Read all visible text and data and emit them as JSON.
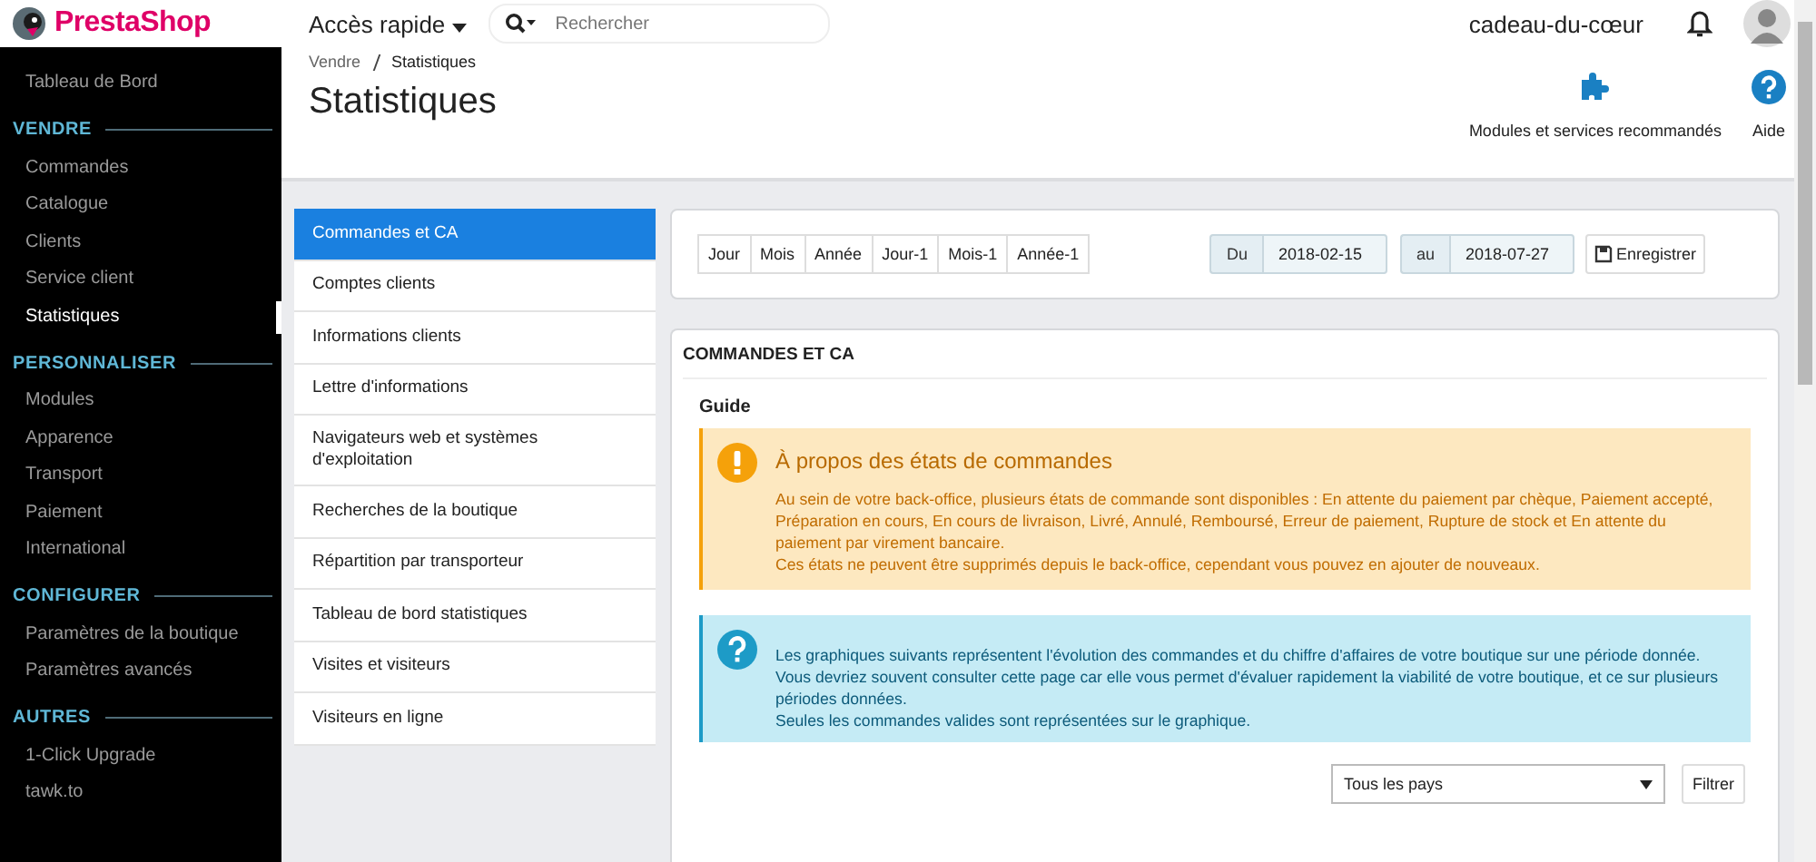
{
  "header": {
    "logo": "PrestaShop",
    "quick_access": "Accès rapide",
    "search": {
      "placeholder": "Rechercher"
    },
    "shop": "cadeau-du-cœur"
  },
  "sidebar": {
    "top_item": {
      "label": "Tableau de Bord",
      "selected": false
    },
    "sections": [
      {
        "title": "VENDRE",
        "items": [
          {
            "label": "Commandes",
            "selected": false
          },
          {
            "label": "Catalogue",
            "selected": false
          },
          {
            "label": "Clients",
            "selected": false
          },
          {
            "label": "Service client",
            "selected": false
          },
          {
            "label": "Statistiques",
            "selected": true
          }
        ]
      },
      {
        "title": "PERSONNALISER",
        "items": [
          {
            "label": "Modules",
            "selected": false
          },
          {
            "label": "Apparence",
            "selected": false
          },
          {
            "label": "Transport",
            "selected": false
          },
          {
            "label": "Paiement",
            "selected": false
          },
          {
            "label": "International",
            "selected": false
          }
        ]
      },
      {
        "title": "CONFIGURER",
        "items": [
          {
            "label": "Paramètres de la boutique",
            "selected": false
          },
          {
            "label": "Paramètres avancés",
            "selected": false
          }
        ]
      },
      {
        "title": "AUTRES",
        "items": [
          {
            "label": "1-Click Upgrade",
            "selected": false
          },
          {
            "label": "tawk.to",
            "selected": false
          }
        ]
      }
    ]
  },
  "breadcrumb": [
    "Vendre",
    "Statistiques"
  ],
  "page_title": "Statistiques",
  "toolbar": [
    {
      "kind": "modules",
      "label": "Modules et services recommandés"
    },
    {
      "kind": "help",
      "label": "Aide"
    }
  ],
  "stats_menu": [
    {
      "label": "Commandes et CA",
      "selected": true
    },
    {
      "label": "Comptes clients",
      "selected": false
    },
    {
      "label": "Informations clients",
      "selected": false
    },
    {
      "label": "Lettre d'informations",
      "selected": false
    },
    {
      "label": "Navigateurs web et systèmes d'exploitation",
      "selected": false
    },
    {
      "label": "Recherches de la boutique",
      "selected": false
    },
    {
      "label": "Répartition par transporteur",
      "selected": false
    },
    {
      "label": "Tableau de bord statistiques",
      "selected": false
    },
    {
      "label": "Visites et visiteurs",
      "selected": false
    },
    {
      "label": "Visiteurs en ligne",
      "selected": false
    }
  ],
  "period_buttons": [
    "Jour",
    "Mois",
    "Année",
    "Jour-1",
    "Mois-1",
    "Année-1"
  ],
  "date_from": {
    "label": "Du",
    "value": "2018-02-15"
  },
  "date_to": {
    "label": "au",
    "value": "2018-07-27"
  },
  "save_button": "Enregistrer",
  "panel": {
    "title": "COMMANDES ET CA",
    "guide": "Guide",
    "alerts": [
      {
        "kind": "warning",
        "title": "À propos des états de commandes",
        "paragraphs": [
          "Au sein de votre back-office, plusieurs états de commande sont disponibles : En attente du paiement par chèque, Paiement accepté, Préparation en cours, En cours de livraison, Livré, Annulé, Remboursé, Erreur de paiement, Rupture de stock et En attente du paiement par virement bancaire.",
          "Ces états ne peuvent être supprimés depuis le back-office, cependant vous pouvez en ajouter de nouveaux."
        ]
      },
      {
        "kind": "info",
        "paragraphs": [
          "Les graphiques suivants représentent l'évolution des commandes et du chiffre d'affaires de votre boutique sur une période donnée.",
          "Vous devriez souvent consulter cette page car elle vous permet d'évaluer rapidement la viabilité de votre boutique, et ce sur plusieurs périodes données.",
          "Seules les commandes valides sont représentées sur le graphique."
        ]
      }
    ],
    "country_select": "Tous les pays",
    "filter_button": "Filtrer"
  }
}
